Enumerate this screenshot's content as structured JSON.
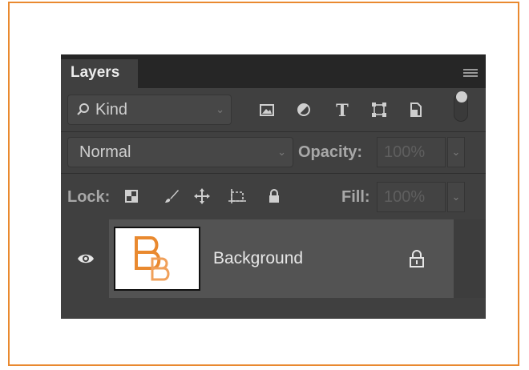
{
  "panel": {
    "tab_label": "Layers",
    "menu_icon": "panel-menu-icon"
  },
  "filter": {
    "kind_label": "Kind",
    "icons": [
      "image-filter-icon",
      "adjustment-filter-icon",
      "type-filter-icon",
      "shape-filter-icon",
      "smart-object-filter-icon"
    ],
    "type_icon_glyph": "T"
  },
  "blend": {
    "mode": "Normal",
    "opacity_label": "Opacity:",
    "opacity_value": "100%"
  },
  "lock": {
    "label": "Lock:",
    "icons": [
      "lock-transparent-pixels-icon",
      "lock-image-pixels-icon",
      "lock-position-icon",
      "lock-artboard-icon",
      "lock-all-icon"
    ],
    "fill_label": "Fill:",
    "fill_value": "100%"
  },
  "layers": [
    {
      "name": "Background",
      "visible": true,
      "locked": true
    }
  ],
  "colors": {
    "accent_orange": "#e9892f",
    "panel_bg": "#404040",
    "selected_row": "#535353"
  }
}
